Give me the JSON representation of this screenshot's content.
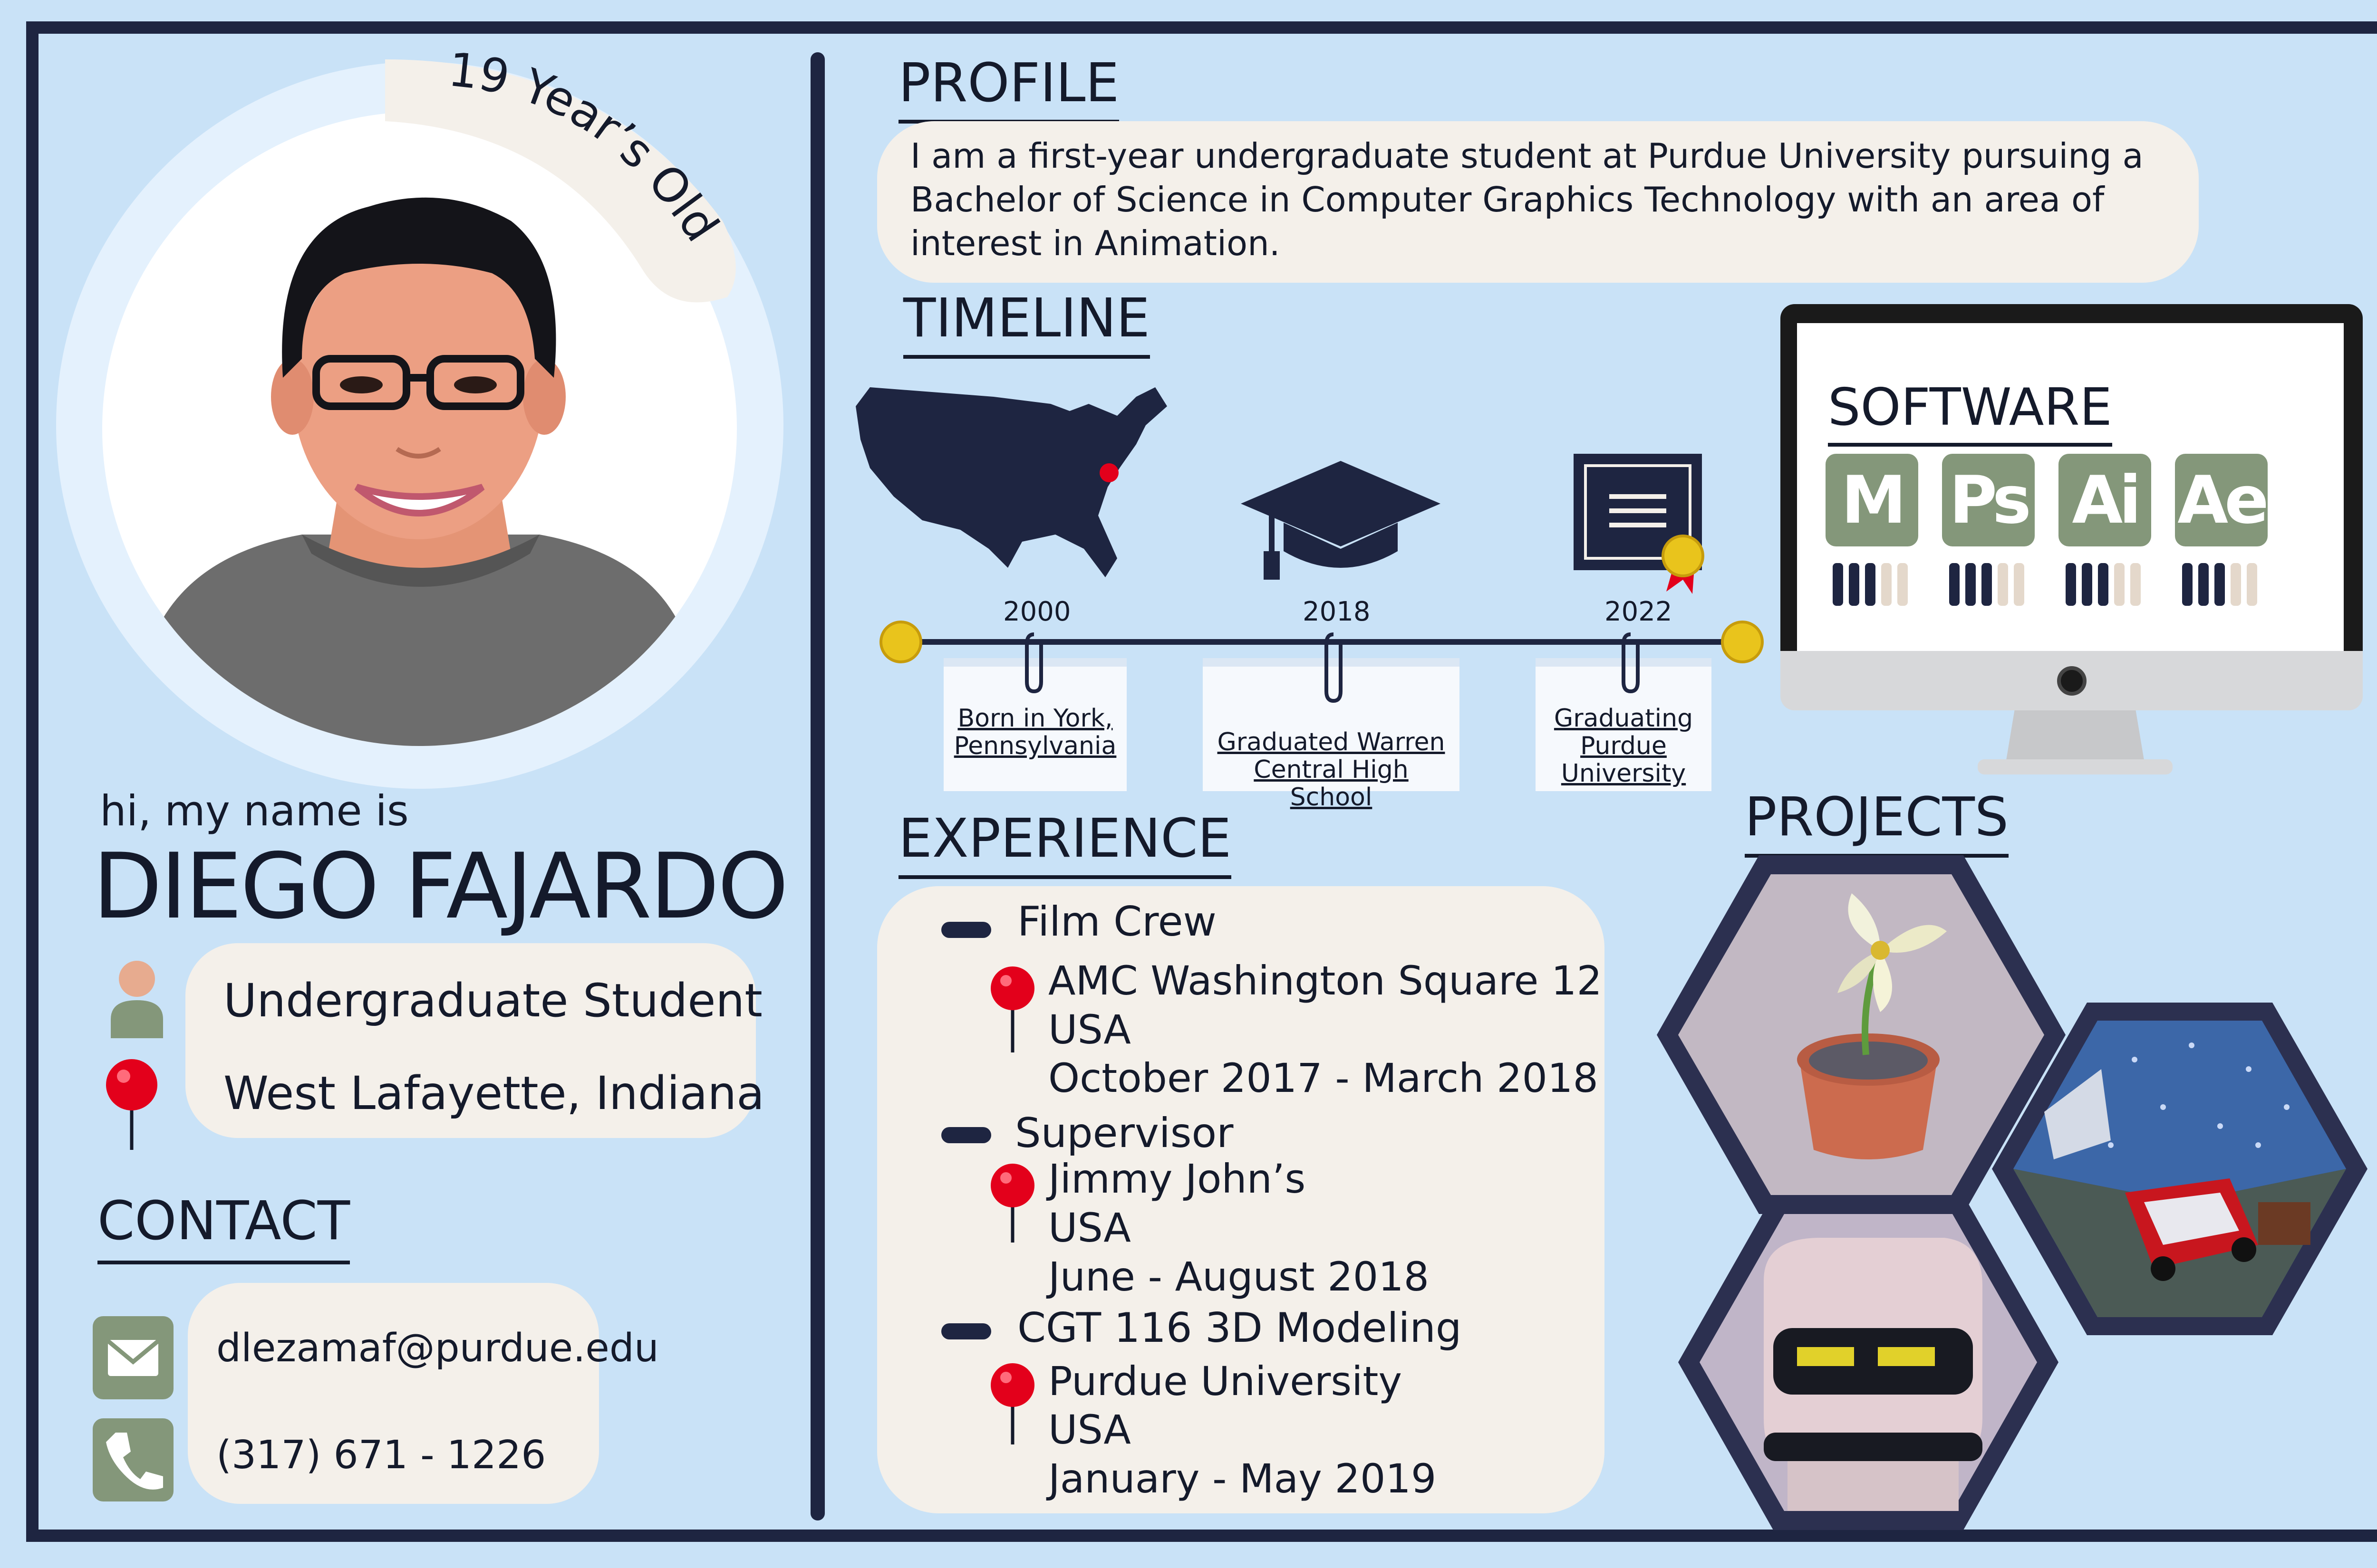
{
  "avatar": {
    "age": "19 Year’s Old"
  },
  "intro": {
    "greeting": "hi, my name is",
    "name": "DIEGO FAJARDO",
    "title": "Undergraduate Student",
    "location": "West Lafayette, Indiana"
  },
  "contact": {
    "heading": "CONTACT",
    "email": "dlezamaf@purdue.edu",
    "phone": "(317) 671 - 1226"
  },
  "profile": {
    "heading": "PROFILE",
    "text": "I am a first-year undergraduate student at Purdue University pursuing a Bachelor of Science in Computer Graphics Technology with an area of interest in Animation."
  },
  "timeline": {
    "heading": "TIMELINE",
    "events": [
      {
        "year": "2000",
        "label": "Born in York, Pennsylvania"
      },
      {
        "year": "2018",
        "label": "Graduated Warren Central High School"
      },
      {
        "year": "2022",
        "label": "Graduating Purdue University"
      }
    ]
  },
  "software": {
    "heading": "SOFTWARE",
    "apps": [
      {
        "abbr": "M",
        "level": 0.6
      },
      {
        "abbr": "Ps",
        "level": 0.6
      },
      {
        "abbr": "Ai",
        "level": 0.6
      },
      {
        "abbr": "Ae",
        "level": 0.6
      }
    ],
    "colors": {
      "tile": "#84977a",
      "bar_filled": "#1e2541",
      "bar_empty": "#e4d8cb"
    }
  },
  "experience": {
    "heading": "EXPERIENCE",
    "items": [
      {
        "role": "Film Crew",
        "place": "AMC Washington Square 12",
        "country": "USA",
        "dates": "October 2017 - March 2018"
      },
      {
        "role": "Supervisor",
        "place": "Jimmy John’s",
        "country": "USA",
        "dates": "June - August 2018"
      },
      {
        "role": "CGT 116 3D Modeling",
        "place": "Purdue University",
        "country": "USA",
        "dates": "January - May 2019"
      }
    ]
  },
  "projects": {
    "heading": "PROJECTS",
    "items": [
      "flower-pot-render",
      "bedroom-render",
      "robot-render"
    ]
  },
  "colors": {
    "background": "#c9e2f7",
    "frame": "#1e2541",
    "card": "#f4f0ea",
    "accent_green": "#84977a",
    "pin_red": "#e3001b",
    "timeline_gold": "#e9c41c"
  }
}
